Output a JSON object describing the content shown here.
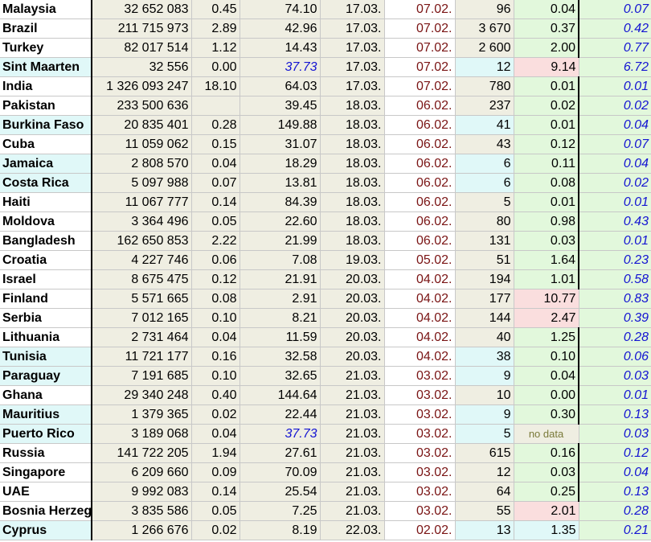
{
  "columns": [
    "country",
    "population",
    "share",
    "value",
    "date_a",
    "date_b",
    "count",
    "ratio",
    "rate"
  ],
  "nodata_label": "no data",
  "rows": [
    {
      "country": "Malaysia",
      "population": "32 652 083",
      "share": "0.45",
      "value": "74.10",
      "date_a": "17.03.",
      "date_b": "07.02.",
      "count": "96",
      "ratio": "0.04",
      "rate": "0.07",
      "name_bg": "white",
      "count_bg": "beige",
      "ratio_bg": "green",
      "value_style": "normal"
    },
    {
      "country": "Brazil",
      "population": "211 715 973",
      "share": "2.89",
      "value": "42.96",
      "date_a": "17.03.",
      "date_b": "07.02.",
      "count": "3 670",
      "ratio": "0.37",
      "rate": "0.42",
      "name_bg": "white",
      "count_bg": "beige",
      "ratio_bg": "green",
      "value_style": "normal"
    },
    {
      "country": "Turkey",
      "population": "82 017 514",
      "share": "1.12",
      "value": "14.43",
      "date_a": "17.03.",
      "date_b": "07.02.",
      "count": "2 600",
      "ratio": "2.00",
      "rate": "0.77",
      "name_bg": "white",
      "count_bg": "beige",
      "ratio_bg": "green",
      "value_style": "normal"
    },
    {
      "country": "Sint Maarten",
      "population": "32 556",
      "share": "0.00",
      "value": "37.73",
      "date_a": "17.03.",
      "date_b": "07.02.",
      "count": "12",
      "ratio": "9.14",
      "rate": "6.72",
      "name_bg": "cyan",
      "count_bg": "cyan",
      "ratio_bg": "pink",
      "value_style": "blue"
    },
    {
      "country": "India",
      "population": "1 326 093 247",
      "share": "18.10",
      "value": "64.03",
      "date_a": "17.03.",
      "date_b": "07.02.",
      "count": "780",
      "ratio": "0.01",
      "rate": "0.01",
      "name_bg": "white",
      "count_bg": "beige",
      "ratio_bg": "green",
      "value_style": "normal"
    },
    {
      "country": "Pakistan",
      "population": "233 500 636",
      "share": "",
      "value": "39.45",
      "date_a": "18.03.",
      "date_b": "06.02.",
      "count": "237",
      "ratio": "0.02",
      "rate": "0.02",
      "name_bg": "white",
      "count_bg": "beige",
      "ratio_bg": "green",
      "value_style": "normal"
    },
    {
      "country": "Burkina Faso",
      "population": "20 835 401",
      "share": "0.28",
      "value": "149.88",
      "date_a": "18.03.",
      "date_b": "06.02.",
      "count": "41",
      "ratio": "0.01",
      "rate": "0.04",
      "name_bg": "cyan",
      "count_bg": "cyan",
      "ratio_bg": "green",
      "value_style": "normal"
    },
    {
      "country": "Cuba",
      "population": "11 059 062",
      "share": "0.15",
      "value": "31.07",
      "date_a": "18.03.",
      "date_b": "06.02.",
      "count": "43",
      "ratio": "0.12",
      "rate": "0.07",
      "name_bg": "white",
      "count_bg": "beige",
      "ratio_bg": "green",
      "value_style": "normal"
    },
    {
      "country": "Jamaica",
      "population": "2 808 570",
      "share": "0.04",
      "value": "18.29",
      "date_a": "18.03.",
      "date_b": "06.02.",
      "count": "6",
      "ratio": "0.11",
      "rate": "0.04",
      "name_bg": "cyan",
      "count_bg": "cyan",
      "ratio_bg": "green",
      "value_style": "normal"
    },
    {
      "country": "Costa Rica",
      "population": "5 097 988",
      "share": "0.07",
      "value": "13.81",
      "date_a": "18.03.",
      "date_b": "06.02.",
      "count": "6",
      "ratio": "0.08",
      "rate": "0.02",
      "name_bg": "cyan",
      "count_bg": "cyan",
      "ratio_bg": "green",
      "value_style": "normal"
    },
    {
      "country": "Haiti",
      "population": "11 067 777",
      "share": "0.14",
      "value": "84.39",
      "date_a": "18.03.",
      "date_b": "06.02.",
      "count": "5",
      "ratio": "0.01",
      "rate": "0.01",
      "name_bg": "white",
      "count_bg": "beige",
      "ratio_bg": "green",
      "value_style": "normal"
    },
    {
      "country": "Moldova",
      "population": "3 364 496",
      "share": "0.05",
      "value": "22.60",
      "date_a": "18.03.",
      "date_b": "06.02.",
      "count": "80",
      "ratio": "0.98",
      "rate": "0.43",
      "name_bg": "white",
      "count_bg": "beige",
      "ratio_bg": "green",
      "value_style": "normal"
    },
    {
      "country": "Bangladesh",
      "population": "162 650 853",
      "share": "2.22",
      "value": "21.99",
      "date_a": "18.03.",
      "date_b": "06.02.",
      "count": "131",
      "ratio": "0.03",
      "rate": "0.01",
      "name_bg": "white",
      "count_bg": "beige",
      "ratio_bg": "green",
      "value_style": "normal"
    },
    {
      "country": "Croatia",
      "population": "4 227 746",
      "share": "0.06",
      "value": "7.08",
      "date_a": "19.03.",
      "date_b": "05.02.",
      "count": "51",
      "ratio": "1.64",
      "rate": "0.23",
      "name_bg": "white",
      "count_bg": "beige",
      "ratio_bg": "green",
      "value_style": "normal"
    },
    {
      "country": "Israel",
      "population": "8 675 475",
      "share": "0.12",
      "value": "21.91",
      "date_a": "20.03.",
      "date_b": "04.02.",
      "count": "194",
      "ratio": "1.01",
      "rate": "0.58",
      "name_bg": "white",
      "count_bg": "beige",
      "ratio_bg": "green",
      "value_style": "normal"
    },
    {
      "country": "Finland",
      "population": "5 571 665",
      "share": "0.08",
      "value": "2.91",
      "date_a": "20.03.",
      "date_b": "04.02.",
      "count": "177",
      "ratio": "10.77",
      "rate": "0.83",
      "name_bg": "white",
      "count_bg": "beige",
      "ratio_bg": "pink",
      "value_style": "normal"
    },
    {
      "country": "Serbia",
      "population": "7 012 165",
      "share": "0.10",
      "value": "8.21",
      "date_a": "20.03.",
      "date_b": "04.02.",
      "count": "144",
      "ratio": "2.47",
      "rate": "0.39",
      "name_bg": "white",
      "count_bg": "beige",
      "ratio_bg": "pink",
      "value_style": "normal"
    },
    {
      "country": "Lithuania",
      "population": "2 731 464",
      "share": "0.04",
      "value": "11.59",
      "date_a": "20.03.",
      "date_b": "04.02.",
      "count": "40",
      "ratio": "1.25",
      "rate": "0.28",
      "name_bg": "white",
      "count_bg": "beige",
      "ratio_bg": "green",
      "value_style": "normal"
    },
    {
      "country": "Tunisia",
      "population": "11 721 177",
      "share": "0.16",
      "value": "32.58",
      "date_a": "20.03.",
      "date_b": "04.02.",
      "count": "38",
      "ratio": "0.10",
      "rate": "0.06",
      "name_bg": "cyan",
      "count_bg": "cyan",
      "ratio_bg": "green",
      "value_style": "normal"
    },
    {
      "country": "Paraguay",
      "population": "7 191 685",
      "share": "0.10",
      "value": "32.65",
      "date_a": "21.03.",
      "date_b": "03.02.",
      "count": "9",
      "ratio": "0.04",
      "rate": "0.03",
      "name_bg": "cyan",
      "count_bg": "cyan",
      "ratio_bg": "green",
      "value_style": "normal"
    },
    {
      "country": "Ghana",
      "population": "29 340 248",
      "share": "0.40",
      "value": "144.64",
      "date_a": "21.03.",
      "date_b": "03.02.",
      "count": "10",
      "ratio": "0.00",
      "rate": "0.01",
      "name_bg": "white",
      "count_bg": "beige",
      "ratio_bg": "green",
      "value_style": "normal"
    },
    {
      "country": "Mauritius",
      "population": "1 379 365",
      "share": "0.02",
      "value": "22.44",
      "date_a": "21.03.",
      "date_b": "03.02.",
      "count": "9",
      "ratio": "0.30",
      "rate": "0.13",
      "name_bg": "cyan",
      "count_bg": "cyan",
      "ratio_bg": "green",
      "value_style": "normal"
    },
    {
      "country": "Puerto Rico",
      "population": "3 189 068",
      "share": "0.04",
      "value": "37.73",
      "date_a": "21.03.",
      "date_b": "03.02.",
      "count": "5",
      "ratio": "",
      "rate": "0.03",
      "name_bg": "cyan",
      "count_bg": "cyan",
      "ratio_bg": "beige",
      "value_style": "blue",
      "ratio_nodata": true
    },
    {
      "country": "Russia",
      "population": "141 722 205",
      "share": "1.94",
      "value": "27.61",
      "date_a": "21.03.",
      "date_b": "03.02.",
      "count": "615",
      "ratio": "0.16",
      "rate": "0.12",
      "name_bg": "white",
      "count_bg": "beige",
      "ratio_bg": "green",
      "value_style": "normal"
    },
    {
      "country": "Singapore",
      "population": "6 209 660",
      "share": "0.09",
      "value": "70.09",
      "date_a": "21.03.",
      "date_b": "03.02.",
      "count": "12",
      "ratio": "0.03",
      "rate": "0.04",
      "name_bg": "white",
      "count_bg": "beige",
      "ratio_bg": "green",
      "value_style": "normal"
    },
    {
      "country": "UAE",
      "population": "9 992 083",
      "share": "0.14",
      "value": "25.54",
      "date_a": "21.03.",
      "date_b": "03.02.",
      "count": "64",
      "ratio": "0.25",
      "rate": "0.13",
      "name_bg": "white",
      "count_bg": "beige",
      "ratio_bg": "green",
      "value_style": "normal"
    },
    {
      "country": "Bosnia Herzegovina",
      "population": "3 835 586",
      "share": "0.05",
      "value": "7.25",
      "date_a": "21.03.",
      "date_b": "03.02.",
      "count": "55",
      "ratio": "2.01",
      "rate": "0.28",
      "name_bg": "white",
      "count_bg": "beige",
      "ratio_bg": "pink",
      "value_style": "normal"
    },
    {
      "country": "Cyprus",
      "population": "1 266 676",
      "share": "0.02",
      "value": "8.19",
      "date_a": "22.03.",
      "date_b": "02.02.",
      "count": "13",
      "ratio": "1.35",
      "rate": "0.21",
      "name_bg": "cyan",
      "count_bg": "cyan",
      "ratio_bg": "cyan",
      "value_style": "normal"
    }
  ]
}
